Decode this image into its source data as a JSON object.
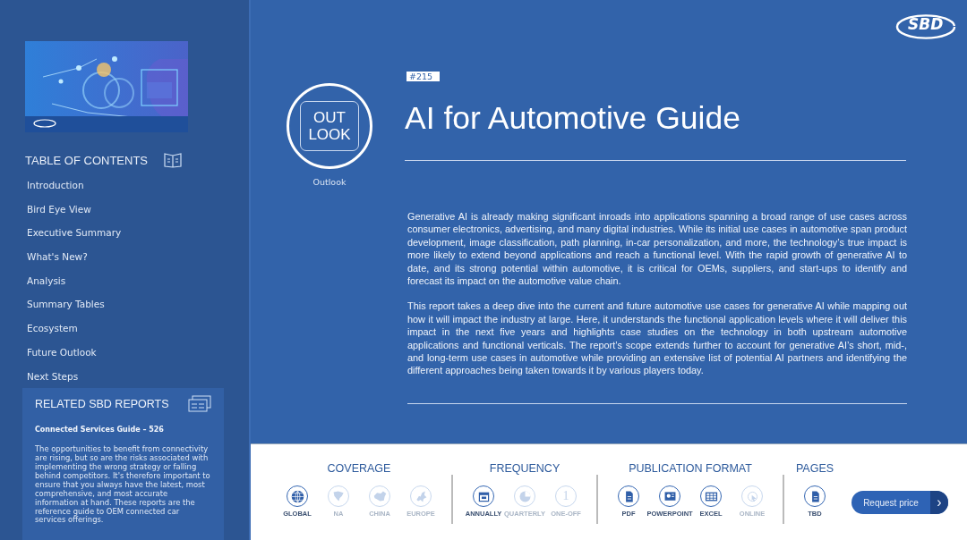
{
  "sidebar": {
    "toc_title": "TABLE OF CONTENTS",
    "toc_items": [
      {
        "label": "Introduction"
      },
      {
        "label": "Bird Eye View"
      },
      {
        "label": "Executive Summary"
      },
      {
        "label": "What's New?"
      },
      {
        "label": "Analysis"
      },
      {
        "label": "Summary Tables"
      },
      {
        "label": "Ecosystem"
      },
      {
        "label": "Future Outlook"
      },
      {
        "label": "Next Steps"
      }
    ],
    "related": {
      "title": "RELATED SBD REPORTS",
      "report_title": "Connected Services Guide – 526",
      "description": "The opportunities to benefit from connectivity are rising, but so are the risks associated with implementing the wrong strategy or falling behind competitors. It's therefore important to ensure that you always have the latest, most comprehensive, and most accurate information at hand. These reports are the reference guide to OEM connected car services offerings."
    }
  },
  "header": {
    "logo": "SBD",
    "badge_line1": "OUT",
    "badge_line2": "LOOK",
    "badge_caption": "Outlook",
    "number": "#215",
    "title": "AI for Automotive Guide"
  },
  "paragraphs": [
    "Generative AI is already making significant inroads into applications spanning a broad range of use cases across consumer electronics, advertising, and many digital industries. While its initial use cases in automotive span product development, image classification, path planning, in-car personalization, and more, the technology’s true impact is more likely to extend beyond applications and reach a functional level. With the rapid growth of generative AI to date, and its strong potential within automotive, it is critical for OEMs, suppliers, and start-ups to identify and forecast its impact on the automotive value chain.",
    "This report takes a deep dive into the current and future automotive use cases for generative AI while mapping out how it will impact the industry at large. Here, it understands the functional application levels where it will deliver this impact in the next five years and highlights case studies on the technology in both upstream automotive applications and functional verticals. The report’s scope extends further to account for generative AI’s short, mid-, and long-term use cases in automotive while providing an extensive list of potential AI partners and identifying the different approaches being taken towards it by various players today."
  ],
  "sections": [
    {
      "title": "COVERAGE",
      "options": [
        {
          "kind": "globe",
          "label": "GLOBAL",
          "selected": true
        },
        {
          "kind": "north-america",
          "label": "NA",
          "selected": false
        },
        {
          "kind": "china",
          "label": "CHINA",
          "selected": false
        },
        {
          "kind": "europe",
          "label": "EUROPE",
          "selected": false
        }
      ]
    },
    {
      "title": "FREQUENCY",
      "options": [
        {
          "kind": "calendar",
          "label": "ANNUALLY",
          "selected": true
        },
        {
          "kind": "pie",
          "label": "QUARTERLY",
          "selected": false
        },
        {
          "kind": "digit",
          "glyph": "1",
          "label": "ONE-OFF",
          "selected": false
        }
      ]
    },
    {
      "title": "PUBLICATION FORMAT",
      "options": [
        {
          "kind": "document",
          "label": "PDF",
          "selected": true
        },
        {
          "kind": "slides",
          "label": "POWERPOINT",
          "selected": true
        },
        {
          "kind": "spreadsheet",
          "label": "EXCEL",
          "selected": true
        },
        {
          "kind": "cursor",
          "label": "ONLINE",
          "selected": false
        }
      ]
    },
    {
      "title": "PAGES",
      "options": [
        {
          "kind": "document",
          "label": "TBD",
          "selected": true
        }
      ]
    }
  ],
  "request_button": {
    "label": "Request price",
    "arrow": "›"
  }
}
